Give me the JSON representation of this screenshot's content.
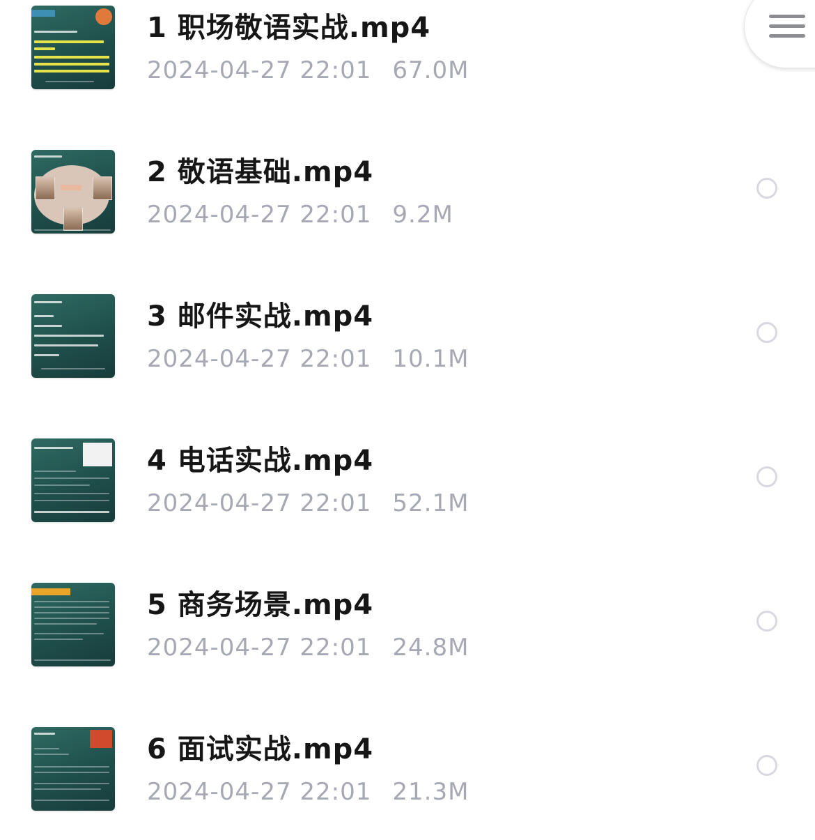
{
  "files": [
    {
      "name": "1 职场敬语实战.mp4",
      "date": "2024-04-27 22:01",
      "size": "67.0M",
      "selected": false
    },
    {
      "name": "2 敬语基础.mp4",
      "date": "2024-04-27 22:01",
      "size": "9.2M",
      "selected": false
    },
    {
      "name": "3 邮件实战.mp4",
      "date": "2024-04-27 22:01",
      "size": "10.1M",
      "selected": false
    },
    {
      "name": "4 电话实战.mp4",
      "date": "2024-04-27 22:01",
      "size": "52.1M",
      "selected": false
    },
    {
      "name": "5 商务场景.mp4",
      "date": "2024-04-27 22:01",
      "size": "24.8M",
      "selected": false
    },
    {
      "name": "6 面试实战.mp4",
      "date": "2024-04-27 22:01",
      "size": "21.3M",
      "selected": false
    }
  ],
  "menu": {
    "icon": "hamburger-menu-icon"
  },
  "colors": {
    "title": "#161616",
    "meta": "#a6a9b3",
    "radio_border": "#d7d9de",
    "thumbnail_bg": "#1f4f4b"
  }
}
